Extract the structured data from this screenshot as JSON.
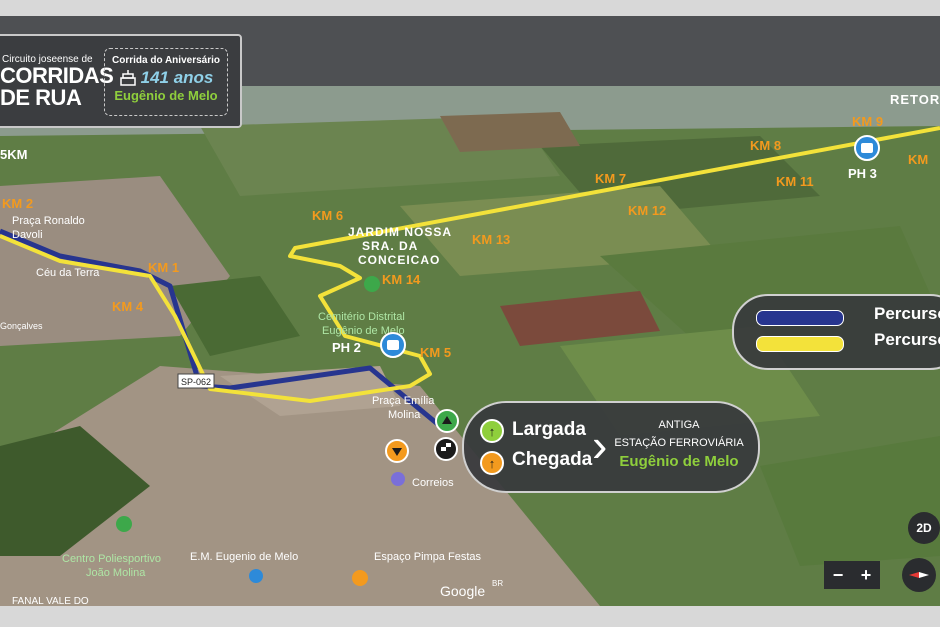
{
  "logo": {
    "small": "Circuito joseense de",
    "line1": "CORRIDAS",
    "line2": "DE RUA",
    "badge_title": "Corrida do Aniversário",
    "badge_years": "141 anos",
    "badge_town": "Eugênio de Melo"
  },
  "legend": {
    "items": [
      {
        "label": "Percurso",
        "color": "#27358f"
      },
      {
        "label": "Percurso",
        "color": "#f3e23a"
      }
    ]
  },
  "start_box": {
    "start_label": "Largada",
    "finish_label": "Chegada",
    "line1": "ANTIGA",
    "line2": "ESTAÇÃO FERROVIÁRIA",
    "line3": "Eugênio de Melo"
  },
  "km_markers": [
    {
      "label": "KM 1"
    },
    {
      "label": "KM 2"
    },
    {
      "label": "KM 4"
    },
    {
      "label": "KM 5"
    },
    {
      "label": "KM 6"
    },
    {
      "label": "KM 7"
    },
    {
      "label": "KM 8"
    },
    {
      "label": "KM 9"
    },
    {
      "label": "KM 11"
    },
    {
      "label": "KM 12"
    },
    {
      "label": "KM 13"
    },
    {
      "label": "KM 14"
    },
    {
      "label": "KM"
    }
  ],
  "map_labels": {
    "five_km": "5KM",
    "retorno": "RETOR",
    "praca_ronaldo": "Praça Ronaldo",
    "davoli": "Davoli",
    "ceu": "Céu da Terra",
    "goncalves": "Gonçalves",
    "jardim1": "JARDIM NOSSA",
    "jardim2": "SRA. DA",
    "jardim3": "CONCEICAO",
    "cemiterio1": "Cemitério Distrital",
    "cemiterio2": "Eugênio de Melo",
    "ph2": "PH 2",
    "ph3": "PH 3",
    "sp062": "SP-062",
    "praca_emilia1": "Praça Emília",
    "praca_emilia2": "Molina",
    "correios": "Correios",
    "centro1": "Centro Poliesportivo",
    "centro2": "João Molina",
    "em": "E.M. Eugenio de Melo",
    "espaco": "Espaço Pimpa Festas",
    "fanal": "FANAL VALE DO",
    "google": "Google",
    "br": "BR"
  },
  "controls": {
    "view_2d": "2D",
    "zoom_out": "−",
    "zoom_in": "+"
  },
  "colors": {
    "route_blue": "#27358f",
    "route_yellow": "#f3e23a",
    "km_orange": "#f39a1e",
    "accent_green": "#8fcf3c"
  }
}
